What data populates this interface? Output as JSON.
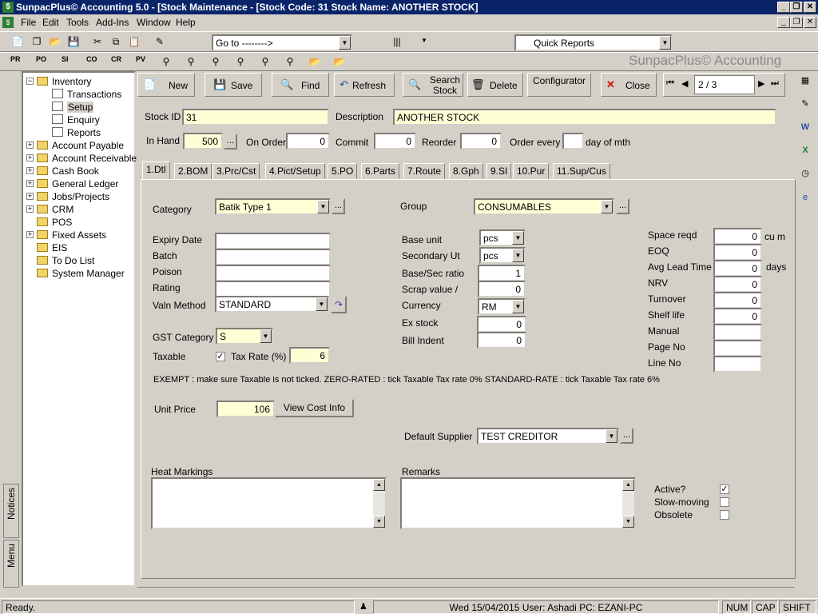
{
  "window": {
    "title": "SunpacPlus© Accounting 5.0 - [Stock Maintenance - [Stock Code: 31 Stock Name: ANOTHER STOCK]"
  },
  "menu": [
    "File",
    "Edit",
    "Tools",
    "Add-Ins",
    "Window",
    "Help"
  ],
  "toolbar": {
    "goto": "Go to -------->",
    "quick_reports": "Quick Reports",
    "watermark": "SunpacPlus© Accounting",
    "doc_buttons": [
      "PR",
      "PO",
      "SI",
      "CO",
      "CR",
      "PV"
    ]
  },
  "tree": [
    {
      "label": "Inventory",
      "type": "folder",
      "expanded": true
    },
    {
      "label": "Transactions",
      "type": "leaf"
    },
    {
      "label": "Setup",
      "type": "leaf",
      "selected": true
    },
    {
      "label": "Enquiry",
      "type": "leaf"
    },
    {
      "label": "Reports",
      "type": "leaf"
    },
    {
      "label": "Account Payable",
      "type": "folder"
    },
    {
      "label": "Account Receivable",
      "type": "folder"
    },
    {
      "label": "Cash Book",
      "type": "folder"
    },
    {
      "label": "General Ledger",
      "type": "folder"
    },
    {
      "label": "Jobs/Projects",
      "type": "folder"
    },
    {
      "label": "CRM",
      "type": "folder"
    },
    {
      "label": "POS",
      "type": "folder"
    },
    {
      "label": "Fixed Assets",
      "type": "folder"
    },
    {
      "label": "EIS",
      "type": "folder"
    },
    {
      "label": "To Do List",
      "type": "folder"
    },
    {
      "label": "System Manager",
      "type": "folder"
    }
  ],
  "side_tabs": {
    "notices": "Notices",
    "menu": "Menu"
  },
  "commands": {
    "new": "New",
    "save": "Save",
    "find": "Find",
    "refresh": "Refresh",
    "search_stock": "Search Stock",
    "delete": "Delete",
    "configurator": "Configurator",
    "close": "Close",
    "record_pos": "2 / 3"
  },
  "header": {
    "stock_id_label": "Stock ID",
    "stock_id": "31",
    "description_label": "Description",
    "description": "ANOTHER STOCK",
    "in_hand_label": "In Hand",
    "in_hand": "500",
    "on_order_label": "On Order",
    "on_order": "0",
    "commit_label": "Commit",
    "commit": "0",
    "reorder_label": "Reorder",
    "reorder": "0",
    "order_every_label": "Order every",
    "order_every": "",
    "order_every_suffix": "day of mth"
  },
  "tabs": [
    "1.Dtl",
    "2.BOM",
    "3.Prc/Cst",
    "4.Pict/Setup",
    "5.PO",
    "6.Parts",
    "7.Route",
    "8.Gph",
    "9.SI",
    "10.Pur",
    "11.Sup/Cus"
  ],
  "detail": {
    "category_label": "Category",
    "category": "Batik Type 1",
    "group_label": "Group",
    "group": "CONSUMABLES",
    "expiry_label": "Expiry Date",
    "expiry": "",
    "batch_label": "Batch",
    "batch": "",
    "poison_label": "Poison",
    "poison": "",
    "rating_label": "Rating",
    "rating": "",
    "valn_label": "Valn Method",
    "valn": "STANDARD",
    "gst_label": "GST Category",
    "gst": "S",
    "taxable_label": "Taxable",
    "taxable": true,
    "tax_rate_label": "Tax Rate (%)",
    "tax_rate": "6",
    "base_unit_label": "Base unit",
    "base_unit": "pcs",
    "secondary_label": "Secondary Ut",
    "secondary": "pcs",
    "ratio_label": "Base/Sec ratio",
    "ratio": "1",
    "scrap_label": "Scrap value /",
    "scrap": "0",
    "currency_label": "Currency",
    "currency": "RM",
    "ex_stock_label": "Ex stock",
    "ex_stock": "0",
    "bill_indent_label": "Bill Indent",
    "bill_indent": "0",
    "space_label": "Space reqd",
    "space": "0",
    "space_unit": "cu m",
    "eoq_label": "EOQ",
    "eoq": "0",
    "lead_label": "Avg Lead Time",
    "lead": "0",
    "lead_unit": "days",
    "nrv_label": "NRV",
    "nrv": "0",
    "turnover_label": "Turnover",
    "turnover": "0",
    "shelf_label": "Shelf life",
    "shelf": "0",
    "manual_label": "Manual",
    "manual": "",
    "page_label": "Page No",
    "page": "",
    "line_label": "Line No",
    "line": "",
    "note": "EXEMPT : make sure Taxable is not ticked. ZERO-RATED : tick Taxable Tax rate 0% STANDARD-RATE : tick Taxable Tax rate 6%",
    "unit_price_label": "Unit Price",
    "unit_price": "106",
    "view_cost": "View Cost Info",
    "supplier_label": "Default Supplier",
    "supplier": "TEST CREDITOR",
    "heat_label": "Heat Markings",
    "heat": "",
    "remarks_label": "Remarks",
    "remarks": "",
    "active_label": "Active?",
    "active": true,
    "slow_label": "Slow-moving",
    "slow": false,
    "obsolete_label": "Obsolete",
    "obsolete": false
  },
  "status": {
    "ready": "Ready.",
    "info": "Wed 15/04/2015 User: Ashadi PC: EZANI-PC",
    "num": "NUM",
    "cap": "CAP",
    "shift": "SHIFT"
  }
}
